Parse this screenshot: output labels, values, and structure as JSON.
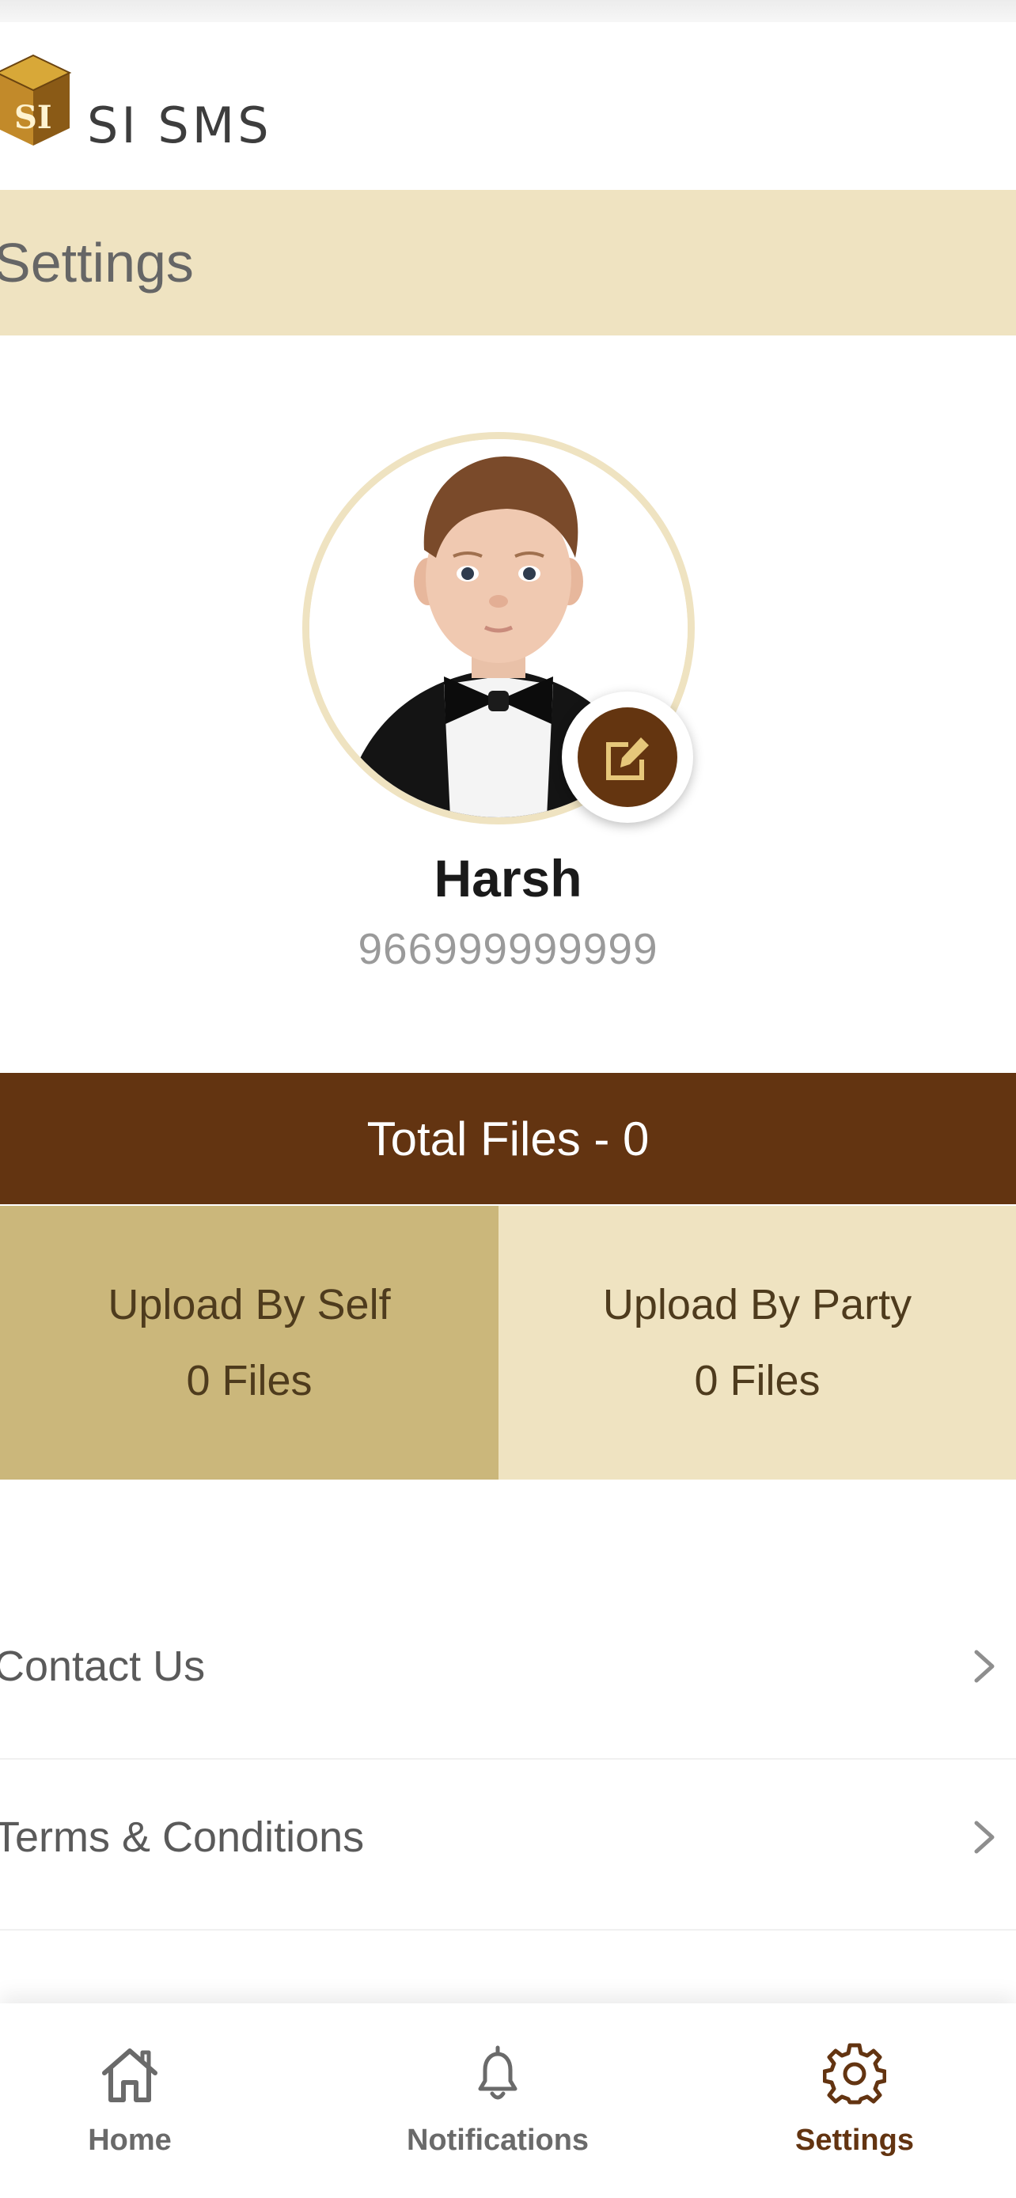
{
  "header": {
    "logo_icon": "si-cube-logo-icon",
    "logo_text": "SI",
    "brand": "SI SMS"
  },
  "page": {
    "title": "Settings"
  },
  "profile": {
    "name": "Harsh",
    "phone": "966999999999",
    "edit_icon": "edit-icon"
  },
  "stats": {
    "total": "Total Files - 0",
    "self_label": "Upload By Self",
    "self_count": "0 Files",
    "party_label": "Upload By Party",
    "party_count": "0 Files"
  },
  "menu": {
    "items": [
      {
        "label": "Contact Us",
        "icon": "chevron-right-icon"
      },
      {
        "label": "Terms & Conditions",
        "icon": "chevron-right-icon"
      }
    ]
  },
  "nav": {
    "items": [
      {
        "label": "Home",
        "icon": "home-icon",
        "active": false
      },
      {
        "label": "Notifications",
        "icon": "bell-icon",
        "active": false
      },
      {
        "label": "Settings",
        "icon": "gear-icon",
        "active": true
      }
    ]
  },
  "colors": {
    "accent_dark": "#633411",
    "accent_light": "#efe3c1",
    "accent_mid": "#cbb77b"
  }
}
